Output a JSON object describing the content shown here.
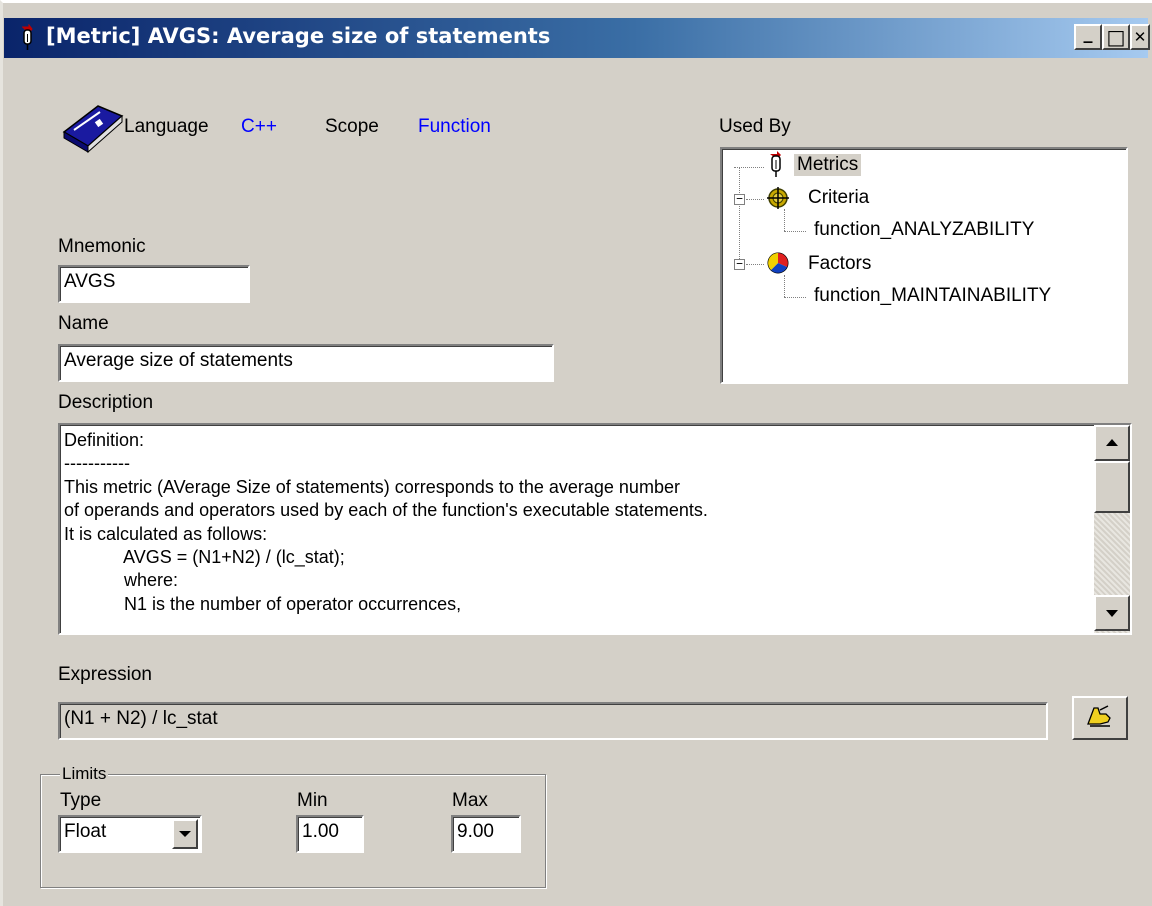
{
  "window": {
    "title": "[Metric] AVGS: Average size of statements",
    "controls": {
      "minimize": "_",
      "maximize": "□",
      "close": "✕"
    }
  },
  "header": {
    "icon": "book-icon",
    "language_label": "Language",
    "language_value": "C++",
    "scope_label": "Scope",
    "scope_value": "Function"
  },
  "used_by": {
    "label": "Used By",
    "tree": [
      {
        "label": "Metrics",
        "icon": "metric-pin-icon",
        "selected": true
      },
      {
        "label": "Criteria",
        "icon": "criteria-target-icon",
        "expanded": true
      },
      {
        "label": "function_ANALYZABILITY"
      },
      {
        "label": "Factors",
        "icon": "factors-pie-icon",
        "expanded": true
      },
      {
        "label": "function_MAINTAINABILITY"
      }
    ],
    "expander_symbol": "−"
  },
  "mnemonic": {
    "label": "Mnemonic",
    "value": "AVGS"
  },
  "name": {
    "label": "Name",
    "value": "Average size of statements"
  },
  "description": {
    "label": "Description",
    "lines": [
      "Definition:",
      "-----------",
      "This metric (AVerage Size of statements) corresponds to the average number",
      "of operands and operators used by each of the function's executable statements.",
      "It is calculated as follows:",
      "            AVGS = (N1+N2) / (lc_stat);",
      "            where:",
      "            N1 is the number of operator occurrences,"
    ]
  },
  "expression": {
    "label": "Expression",
    "value": "(N1 + N2) / lc_stat",
    "edit_icon": "hand-pencil-icon"
  },
  "limits": {
    "group_label": "Limits",
    "type_label": "Type",
    "type_value": "Float",
    "min_label": "Min",
    "min_value": "1.00",
    "max_label": "Max",
    "max_value": "9.00"
  },
  "colors": {
    "titlebar_start": "#0a246a",
    "titlebar_end": "#a6caf0",
    "face": "#d4d0c8",
    "value_blue": "#0000ff"
  }
}
